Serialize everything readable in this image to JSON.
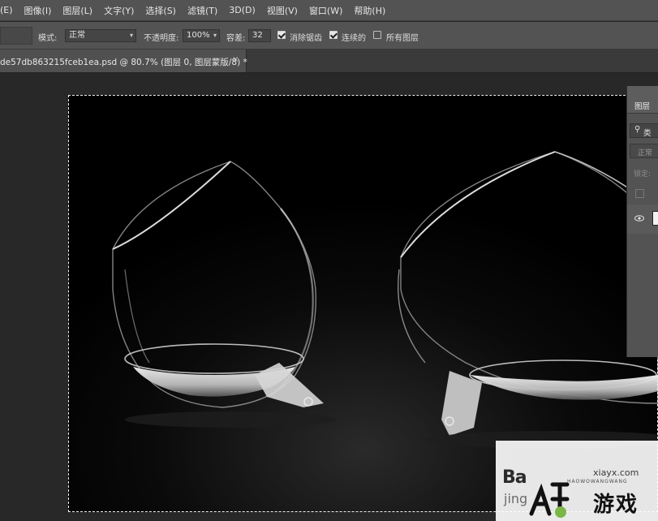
{
  "menu": {
    "items": [
      "(E)",
      "图像(I)",
      "图层(L)",
      "文字(Y)",
      "选择(S)",
      "滤镜(T)",
      "3D(D)",
      "视图(V)",
      "窗口(W)",
      "帮助(H)"
    ]
  },
  "options": {
    "mode_label": "模式:",
    "mode_value": "正常",
    "opacity_label": "不透明度:",
    "opacity_value": "100%",
    "tolerance_label": "容差:",
    "tolerance_value": "32",
    "antialias_label": "消除锯齿",
    "antialias_checked": true,
    "contiguous_label": "连续的",
    "contiguous_checked": true,
    "all_layers_label": "所有图层",
    "all_layers_checked": false
  },
  "document": {
    "tab_title": "de57db863215fceb1ea.psd @ 80.7% (图层 0, 图层蒙版/8) *",
    "close_glyph": "×"
  },
  "layers_panel": {
    "tab_label": "图层",
    "search_text": "类",
    "search_icon": "magnifier-icon",
    "blend_mode": "正常",
    "lock_label": "锁定:"
  },
  "watermark": {
    "baidu_text": "Ba",
    "jingyan_text": "jing",
    "site_text": "xiayx.com",
    "small_text": "HAOWOWANGWANG",
    "youxi_text": "游戏",
    "accent_color": "#7ab648"
  },
  "colors": {
    "menubar_bg": "#535353",
    "workspace_bg": "#282828",
    "canvas_bg": "#000000"
  }
}
